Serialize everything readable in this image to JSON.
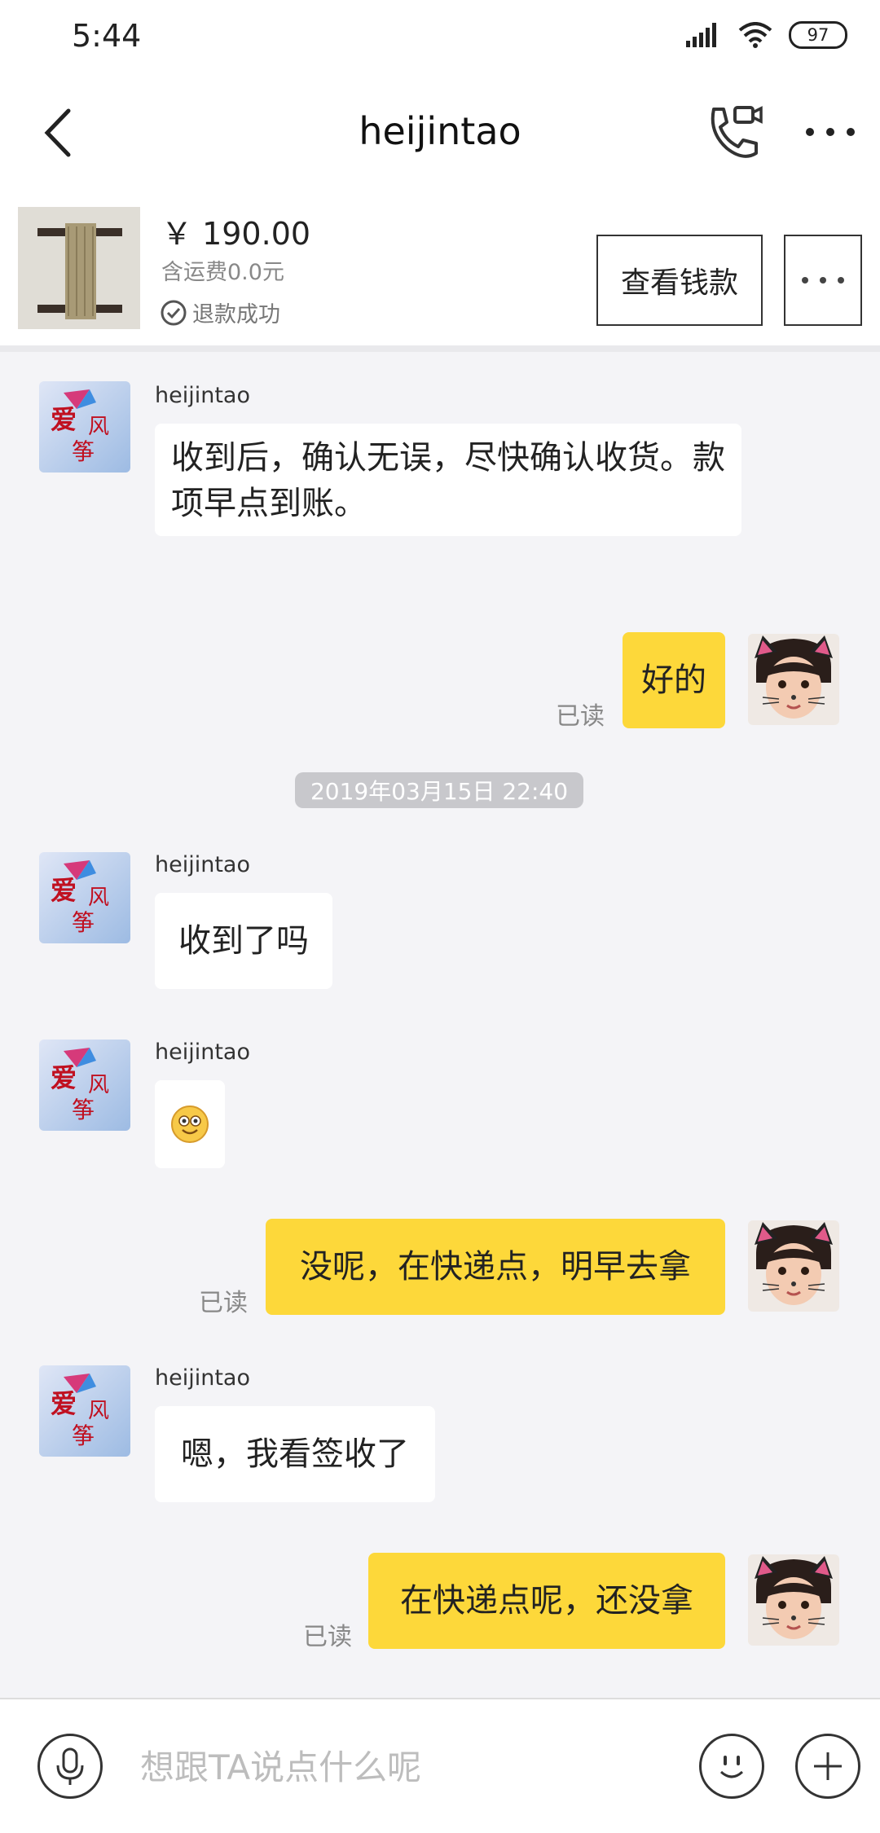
{
  "status": {
    "time": "5:44",
    "battery": "97"
  },
  "header": {
    "title": "heijintao"
  },
  "product": {
    "price": "￥ 190.00",
    "shipping": "含运费0.0元",
    "status": "退款成功",
    "view_button": "查看钱款"
  },
  "messages": [
    {
      "side": "in",
      "sender": "heijintao",
      "text": "收到后，确认无误，尽快确认收货。款项早点到账。"
    },
    {
      "side": "out",
      "text": "好的",
      "read": "已读"
    },
    {
      "timestamp": "2019年03月15日 22:40"
    },
    {
      "side": "in",
      "sender": "heijintao",
      "text": "收到了吗"
    },
    {
      "side": "in",
      "sender": "heijintao",
      "text": "",
      "emoji": "smile-emoji"
    },
    {
      "side": "out",
      "text": "没呢，在快递点，明早去拿",
      "read": "已读"
    },
    {
      "side": "in",
      "sender": "heijintao",
      "text": "嗯，我看签收了"
    },
    {
      "side": "out",
      "text": "在快递点呢，还没拿",
      "read": "已读"
    }
  ],
  "peer_avatar_text": [
    "爱",
    "风",
    "筝"
  ],
  "input": {
    "placeholder": "想跟TA说点什么呢"
  },
  "colors": {
    "outgoing_bubble": "#fdd83a",
    "incoming_bubble": "#ffffff",
    "background": "#f4f4f7"
  }
}
